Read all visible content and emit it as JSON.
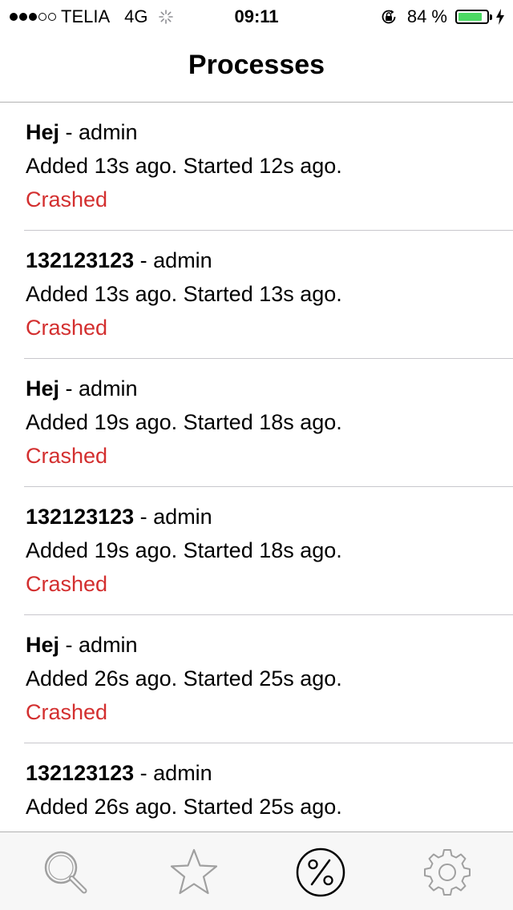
{
  "status_bar": {
    "signal_dots_filled": 3,
    "signal_dots_total": 5,
    "carrier": "TELIA",
    "network": "4G",
    "time": "09:11",
    "battery_percent_label": "84 %",
    "battery_level": 0.84,
    "battery_color": "#4cd964"
  },
  "nav": {
    "title": "Processes"
  },
  "processes": [
    {
      "name": "Hej",
      "separator": " - ",
      "user": "admin",
      "detail": "Added 13s ago. Started 12s ago.",
      "status": "Crashed"
    },
    {
      "name": "132123123",
      "separator": " - ",
      "user": "admin",
      "detail": "Added 13s ago. Started 13s ago.",
      "status": "Crashed"
    },
    {
      "name": "Hej",
      "separator": " - ",
      "user": "admin",
      "detail": "Added 19s ago. Started 18s ago.",
      "status": "Crashed"
    },
    {
      "name": "132123123",
      "separator": " - ",
      "user": "admin",
      "detail": "Added 19s ago. Started 18s ago.",
      "status": "Crashed"
    },
    {
      "name": "Hej",
      "separator": " - ",
      "user": "admin",
      "detail": "Added 26s ago. Started 25s ago.",
      "status": "Crashed"
    },
    {
      "name": "132123123",
      "separator": " - ",
      "user": "admin",
      "detail": "Added 26s ago. Started 25s ago.",
      "status": ""
    }
  ],
  "status_color": "#d32f2f",
  "tabs": [
    {
      "icon": "search-icon",
      "selected": false
    },
    {
      "icon": "star-icon",
      "selected": false
    },
    {
      "icon": "percent-icon",
      "selected": true
    },
    {
      "icon": "gear-icon",
      "selected": false
    }
  ]
}
